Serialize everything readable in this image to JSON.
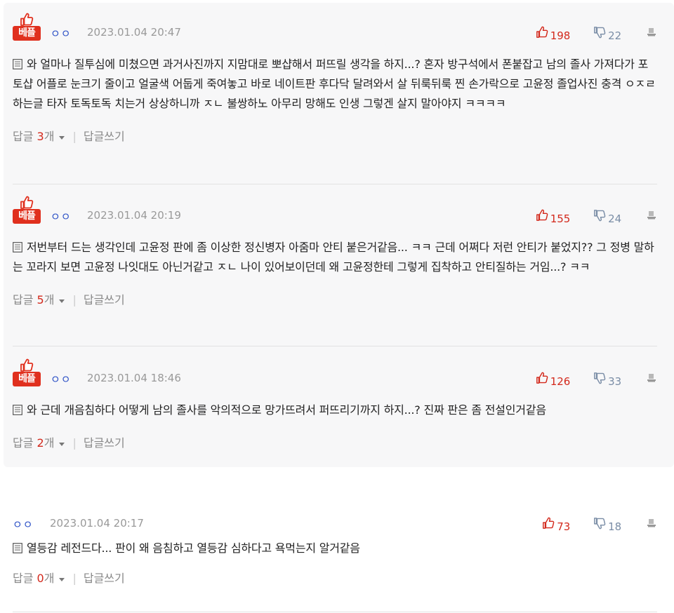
{
  "best_label": "베플",
  "comments": [
    {
      "nick": "ㅇㅇ",
      "time": "2023.01.04 20:47",
      "up": "198",
      "down": "22",
      "text": "와 얼마나 질투심에 미쳤으면 과거사진까지 지맘대로 뽀샵해서 퍼뜨릴 생각을 하지...? 혼자 방구석에서 폰붙잡고 남의 졸사 가져다가 포토샵 어플로 눈크기 줄이고 얼굴색 어둡게 죽여놓고 바로 네이트판 후다닥 달려와서 살 뒤룩뒤룩 찐 손가락으로 고윤정 졸업사진 충격 ㅇㅈㄹ 하는글 타자 토독토독 치는거 상상하니까 ㅈㄴ 불쌍하노 아무리 망해도 인생 그렇겐 살지 말아야지 ㅋㅋㅋㅋ",
      "reply_prefix": "답글 ",
      "reply_count": "3",
      "reply_suffix": "개",
      "write_reply": "답글쓰기"
    },
    {
      "nick": "ㅇㅇ",
      "time": "2023.01.04 20:19",
      "up": "155",
      "down": "24",
      "text": "저번부터 드는 생각인데 고윤정 판에 좀 이상한 정신병자 아줌마 안티 붙은거같음... ㅋㅋ 근데 어쩌다 저런 안티가 붙었지?? 그 정병 말하는 꼬라지 보면 고윤정 나잇대도 아닌거같고 ㅈㄴ 나이 있어보이던데 왜 고윤정한테 그렇게 집착하고 안티질하는 거임...? ㅋㅋ",
      "reply_prefix": "답글 ",
      "reply_count": "5",
      "reply_suffix": "개",
      "write_reply": "답글쓰기"
    },
    {
      "nick": "ㅇㅇ",
      "time": "2023.01.04 18:46",
      "up": "126",
      "down": "33",
      "text": "와 근데 개음침하다 어떻게 남의 졸사를 악의적으로 망가뜨려서 퍼뜨리기까지 하지...? 진짜 판은 좀 전설인거같음",
      "reply_prefix": "답글 ",
      "reply_count": "2",
      "reply_suffix": "개",
      "write_reply": "답글쓰기"
    },
    {
      "nick": "ㅇㅇ",
      "time": "2023.01.04 20:17",
      "up": "73",
      "down": "18",
      "text": "열등감 레전드다... 판이 왜 음침하고 열등감 심하다고 욕먹는지 알거같음",
      "reply_prefix": "답글 ",
      "reply_count": "0",
      "reply_suffix": "개",
      "write_reply": "답글쓰기"
    }
  ],
  "icons": {
    "thumb_up": "thumbs-up-icon",
    "thumb_down": "thumbs-down-icon",
    "report": "report-icon",
    "document": "document-icon",
    "caret": "caret-down-icon"
  },
  "colors": {
    "accent": "#d3291c",
    "nick": "#2f53c7",
    "badge": "#e0301e"
  }
}
